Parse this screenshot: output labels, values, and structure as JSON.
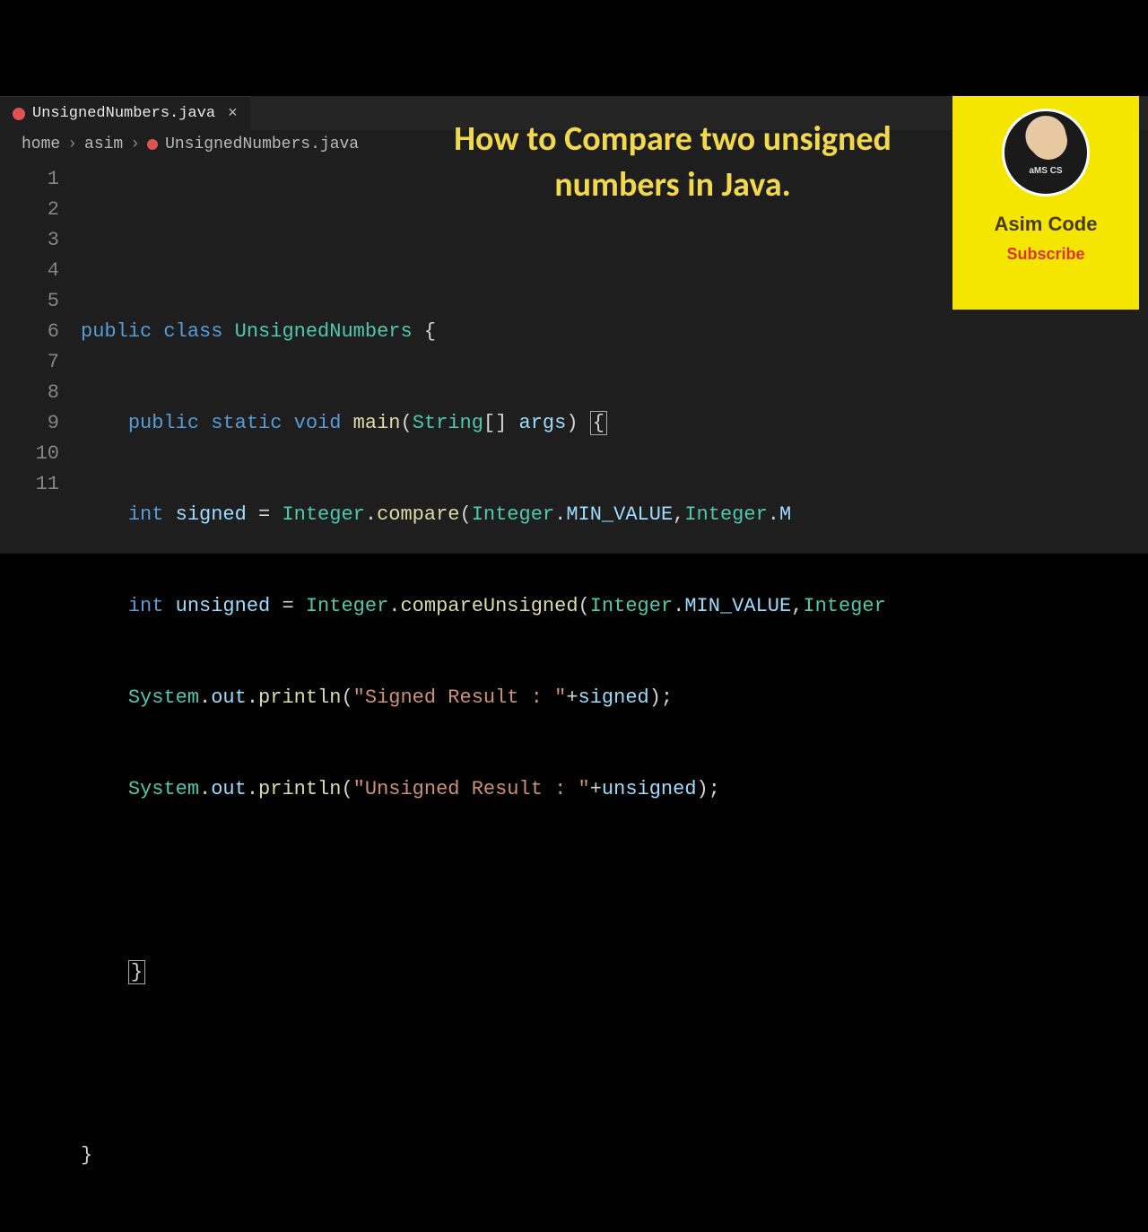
{
  "tab": {
    "filename": "UnsignedNumbers.java",
    "close_glyph": "×"
  },
  "breadcrumb": {
    "items": [
      "home",
      "asim",
      "UnsignedNumbers.java"
    ],
    "separator": "›"
  },
  "overlay": {
    "title": "How to Compare two unsigned numbers in Java."
  },
  "channel": {
    "name": "Asim Code",
    "subscribe": "Subscribe"
  },
  "code": {
    "line_numbers": [
      "1",
      "2",
      "3",
      "4",
      "5",
      "6",
      "7",
      "8",
      "9",
      "10",
      "11"
    ],
    "tokens": {
      "l2_public": "public",
      "l2_class": "class",
      "l2_name": "UnsignedNumbers",
      "l2_brace": "{",
      "l3_public": "public",
      "l3_static": "static",
      "l3_void": "void",
      "l3_main": "main",
      "l3_string": "String",
      "l3_args": "args",
      "l3_brace": "{",
      "l4_int": "int",
      "l4_var": "signed",
      "l4_eq": "=",
      "l4_integer1": "Integer",
      "l4_compare": "compare",
      "l4_integer2": "Integer",
      "l4_min": "MIN_VALUE",
      "l4_integer3": "Integer",
      "l4_max_cut": "M",
      "l5_int": "int",
      "l5_var": "unsigned",
      "l5_eq": "=",
      "l5_integer1": "Integer",
      "l5_cmpu": "compareUnsigned",
      "l5_integer2": "Integer",
      "l5_min": "MIN_VALUE",
      "l5_integer3": "Integer",
      "l6_system": "System",
      "l6_out": "out",
      "l6_println": "println",
      "l6_str": "\"Signed Result : \"",
      "l6_plus": "+",
      "l6_var": "signed",
      "l7_system": "System",
      "l7_out": "out",
      "l7_println": "println",
      "l7_str": "\"Unsigned Result : \"",
      "l7_plus": "+",
      "l7_var": "unsigned",
      "l9_brace": "}",
      "l11_brace": "}"
    }
  }
}
